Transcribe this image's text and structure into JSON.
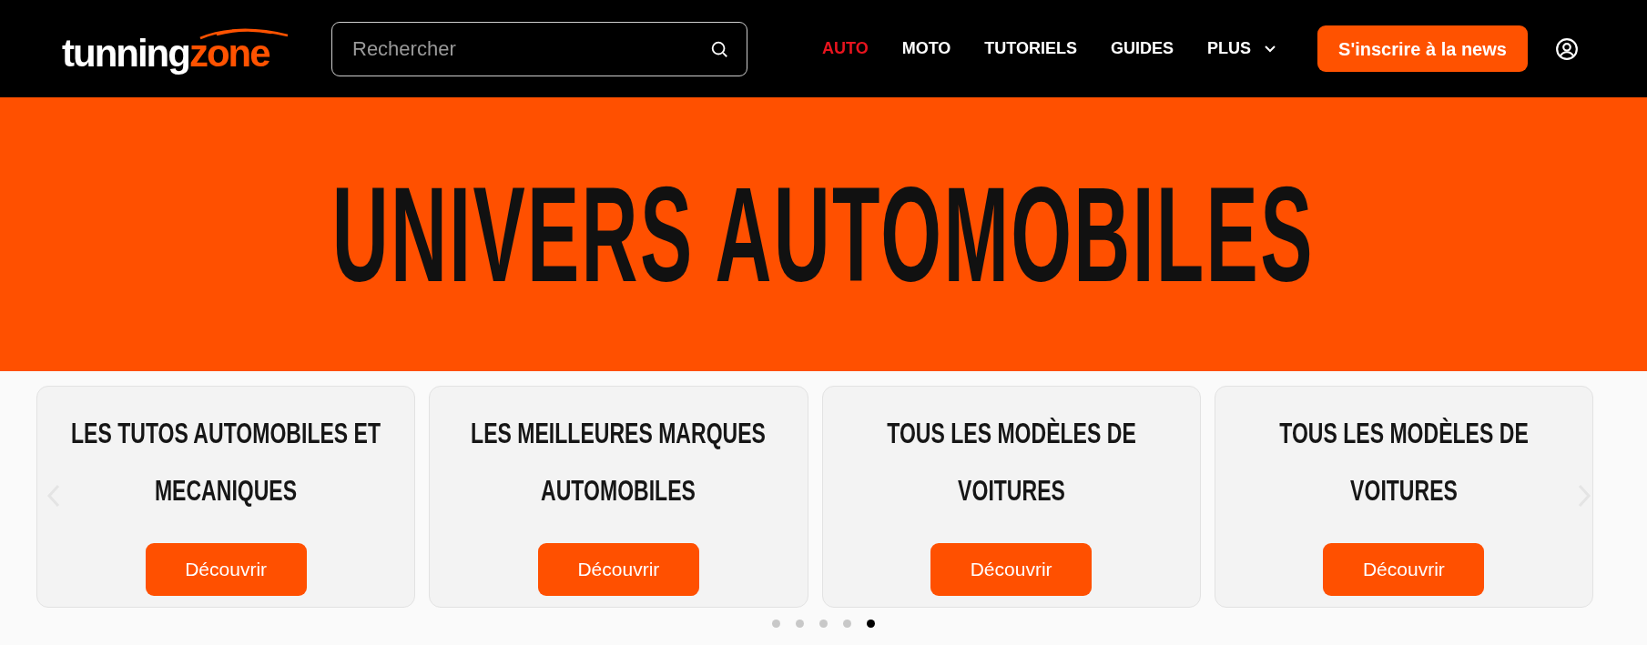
{
  "header": {
    "logo": {
      "part_1": "tunning",
      "part_2": "zone"
    },
    "search": {
      "placeholder": "Rechercher"
    },
    "nav": [
      {
        "label": "AUTO",
        "selected": true,
        "dropdown": false
      },
      {
        "label": "MOTO",
        "selected": false,
        "dropdown": false
      },
      {
        "label": "TUTORIELS",
        "selected": false,
        "dropdown": false
      },
      {
        "label": "GUIDES",
        "selected": false,
        "dropdown": false
      },
      {
        "label": "PLUS",
        "selected": false,
        "dropdown": true
      }
    ],
    "newsletter_button": "S'inscrire à la news"
  },
  "hero": {
    "title": "UNIVERS AUTOMOBILES"
  },
  "carousel": {
    "cards": [
      {
        "title": "LES TUTOS AUTOMOBILES ET MECANIQUES",
        "button": "Découvrir"
      },
      {
        "title": "LES MEILLEURES MARQUES AUTOMOBILES",
        "button": "Découvrir"
      },
      {
        "title": "TOUS LES MODÈLES DE VOITURES",
        "button": "Découvrir"
      },
      {
        "title": "TOUS LES MODÈLES DE VOITURES",
        "button": "Découvrir"
      }
    ],
    "dots": [
      {
        "selected": false
      },
      {
        "selected": false
      },
      {
        "selected": false
      },
      {
        "selected": false
      },
      {
        "selected": true
      }
    ]
  }
}
